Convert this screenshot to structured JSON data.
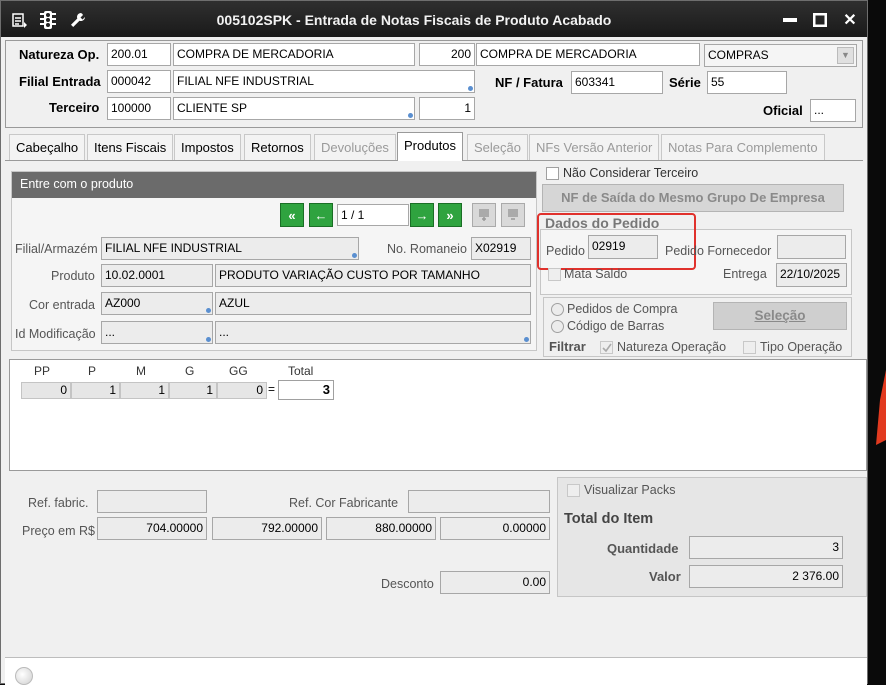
{
  "window": {
    "title": "005102SPK - Entrada de Notas Fiscais de Produto Acabado",
    "minimize": "▬",
    "maximize": "■",
    "close": "✕"
  },
  "header": {
    "natureza_label": "Natureza Op.",
    "natureza_code": "200.01",
    "natureza_desc": "COMPRA DE MERCADORIA",
    "natureza_num": "200",
    "natureza_desc2": "COMPRA DE MERCADORIA",
    "natureza_type": "COMPRAS",
    "filial_label": "Filial Entrada",
    "filial_code": "000042",
    "filial_desc": "FILIAL NFE INDUSTRIAL",
    "nf_label": "NF / Fatura",
    "nf_value": "603341",
    "serie_label": "Série",
    "serie_value": "55",
    "terceiro_label": "Terceiro",
    "terceiro_code": "100000",
    "terceiro_desc": "CLIENTE SP",
    "terceiro_num": "1",
    "oficial_label": "Oficial",
    "oficial_value": "..."
  },
  "tabs": [
    "Cabeçalho",
    "Itens Fiscais",
    "Impostos",
    "Retornos",
    "Devoluções",
    "Produtos",
    "Seleção",
    "NFs Versão Anterior",
    "Notas Para Complemento"
  ],
  "produto": {
    "panel_title": "Entre com o produto",
    "pager": "1 / 1",
    "filial_label": "Filial/Armazém",
    "filial_value": "FILIAL NFE INDUSTRIAL",
    "romaneio_label": "No. Romaneio",
    "romaneio_value": "X02919",
    "produto_label": "Produto",
    "produto_code": "10.02.0001",
    "produto_desc": "PRODUTO VARIAÇÃO CUSTO POR TAMANHO",
    "cor_label": "Cor entrada",
    "cor_code": "AZ000",
    "cor_desc": "AZUL",
    "idmod_label": "Id Modificação",
    "idmod_code": "...",
    "idmod_desc": "..."
  },
  "pedido": {
    "nao_considerar": "Não Considerar Terceiro",
    "nf_saida_button": "NF de Saída do Mesmo Grupo De Empresa",
    "section_title": "Dados do Pedido",
    "pedido_label": "Pedido",
    "pedido_value": "02919",
    "fornecedor_label": "Pedido Fornecedor",
    "fornecedor_value": "",
    "mata_saldo": "Mata Saldo",
    "entrega_label": "Entrega",
    "entrega_value": "22/10/2025",
    "radio_pedidos": "Pedidos de Compra",
    "radio_codigo": "Código de Barras",
    "selecao_button": "Seleção",
    "filtrar_label": "Filtrar",
    "natureza_op": "Natureza Operação",
    "tipo_op": "Tipo Operação"
  },
  "grade": {
    "headers": [
      "PP",
      "P",
      "M",
      "G",
      "GG",
      "Total"
    ],
    "values": [
      "0",
      "1",
      "1",
      "1",
      "0"
    ],
    "equals": "=",
    "total": "3"
  },
  "precos": {
    "ref_fabric_label": "Ref. fabric.",
    "ref_cor_label": "Ref. Cor Fabricante",
    "preco_label": "Preço em R$",
    "precos": [
      "704.00000",
      "792.00000",
      "880.00000",
      "0.00000"
    ],
    "desconto_label": "Desconto",
    "desconto_value": "0.00"
  },
  "total": {
    "visualizar_packs": "Visualizar Packs",
    "title": "Total do Item",
    "quantidade_label": "Quantidade",
    "quantidade_value": "3",
    "valor_label": "Valor",
    "valor_value": "2 376.00"
  },
  "colors": {
    "title_bg": "#222222",
    "highlight": "#e0312c",
    "nav_green": "#2fa33f",
    "panel_title_bg": "#6b6b6b"
  }
}
